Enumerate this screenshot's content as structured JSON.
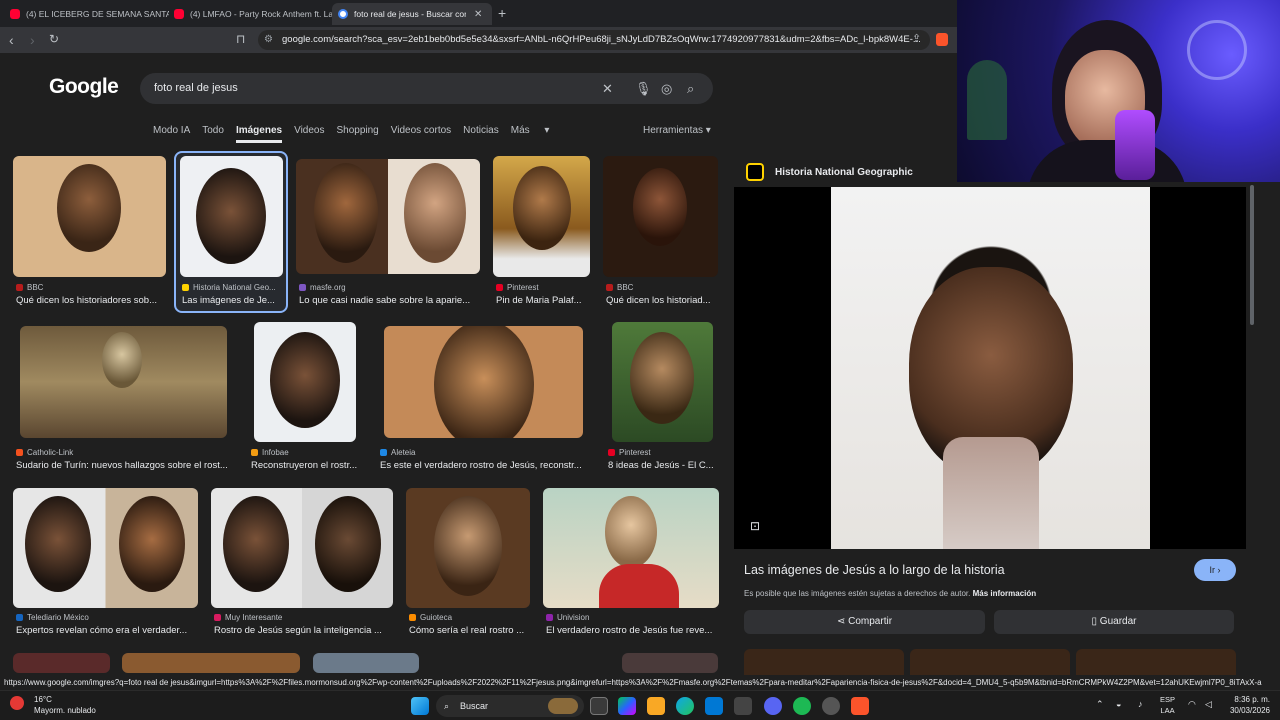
{
  "browser": {
    "tabs": [
      {
        "title": "(4) EL ICEBERG DE SEMANA SANTA -",
        "favicon": "youtube-icon"
      },
      {
        "title": "(4) LMFAO - Party Rock Anthem ft. La",
        "favicon": "youtube-icon"
      },
      {
        "title": "foto real de jesus - Buscar con G",
        "favicon": "google-icon",
        "active": true
      }
    ],
    "url": "google.com/search?sca_esv=2eb1beb0bd5e5e34&sxsrf=ANbL-n6QrHPeu68ji_sNJyLdD7BZsOqWrw:1774920977831&udm=2&fbs=ADc_l-bpk8W4E-..."
  },
  "google": {
    "logo": "Google",
    "query": "foto real de jesus",
    "tabs": [
      "Modo IA",
      "Todo",
      "Imágenes",
      "Videos",
      "Shopping",
      "Videos cortos",
      "Noticias",
      "Más"
    ],
    "active_tab": "Imágenes",
    "tools": "Herramientas"
  },
  "results": [
    {
      "source": "BBC",
      "title": "Qué dicen los historiadores sob...",
      "color": "#b71c1c"
    },
    {
      "source": "Historia National Geo...",
      "title": "Las imágenes de Je...",
      "color": "#ffd200"
    },
    {
      "source": "masfe.org",
      "title": "Lo que casi nadie sabe sobre la aparie...",
      "color": "#7e57c2"
    },
    {
      "source": "Pinterest",
      "title": "Pin de Maria Palaf...",
      "color": "#e60023"
    },
    {
      "source": "BBC",
      "title": "Qué dicen los historiad...",
      "color": "#b71c1c"
    },
    {
      "source": "Catholic-Link",
      "title": "Sudario de Turín: nuevos hallazgos sobre el rost...",
      "color": "#f4511e"
    },
    {
      "source": "Infobae",
      "title": "Reconstruyeron el rostr...",
      "color": "#f39c12"
    },
    {
      "source": "Aleteia",
      "title": "Es este el verdadero rostro de Jesús, reconstr...",
      "color": "#1e88e5"
    },
    {
      "source": "Pinterest",
      "title": "8 ideas de Jesús - El C...",
      "color": "#e60023"
    },
    {
      "source": "Telediario México",
      "title": "Expertos revelan cómo era el verdader...",
      "color": "#1565c0"
    },
    {
      "source": "Muy Interesante",
      "title": "Rostro de Jesús según la inteligencia ...",
      "color": "#d81b60"
    },
    {
      "source": "Guioteca",
      "title": "Cómo sería el real rostro ...",
      "color": "#fb8c00"
    },
    {
      "source": "Univision",
      "title": "El verdadero rostro de Jesús fue reve...",
      "color": "#8e24aa"
    }
  ],
  "preview": {
    "source": "Historia National Geographic",
    "title": "Las imágenes de Jesús a lo largo de la historia",
    "go": "Ir",
    "copyright": "Es posible que las imágenes estén sujetas a derechos de autor.",
    "more": "Más información",
    "share": "Compartir",
    "save": "Guardar"
  },
  "status_url": "https://www.google.com/imgres?q=foto real de jesus&imgurl=https%3A%2F%2Ffiles.mormonsud.org%2Fwp-content%2Fuploads%2F2022%2F11%2Fjesus.png&imgrefurl=https%3A%2F%2Fmasfe.org%2Ftemas%2Fpara-meditar%2Fapariencia-fisica-de-jesus%2F&docid=4_DMU4_5-q5b9M&tbnid=bRmCRMPkW4Z2PM&vet=12ahUKEwjml7P0_8iTAxX-aD...",
  "taskbar": {
    "temp": "16°C",
    "weather": "Mayorm. nublado",
    "search": "Buscar",
    "lang1": "ESP",
    "lang2": "LAA",
    "time": "8:36 p. m.",
    "date": "30/03/2026"
  }
}
